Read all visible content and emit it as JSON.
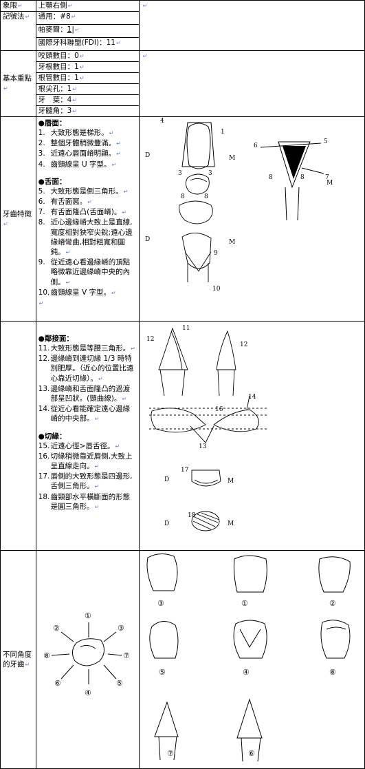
{
  "header": {
    "quadrant_label": "象限",
    "quadrant_value": "上顎右側"
  },
  "notation": {
    "label": "記號法",
    "universal": "通用：#8",
    "palmer_prefix": "帕麥爾：",
    "palmer_value": "1",
    "fdi": "國際牙科聯盟(FDI)：11"
  },
  "basics": {
    "label": "基本重點",
    "items": [
      "咬頭數目：0",
      "牙根數目：1",
      "根管數目：1",
      "根尖孔：1",
      "牙　葉：4",
      "牙髓角：3"
    ]
  },
  "features": {
    "label": "牙齒特徵",
    "labial": {
      "title": "●唇面：",
      "items": [
        {
          "n": "1.",
          "t": "大致形態是梯形。"
        },
        {
          "n": "2.",
          "t": "整個牙體稍微豐滿。"
        },
        {
          "n": "3.",
          "t": "近遠心唇面嵴明顯。"
        },
        {
          "n": "4.",
          "t": "齒頸線呈 U 字型。"
        }
      ]
    },
    "lingual": {
      "title": "●舌面：",
      "items": [
        {
          "n": "5.",
          "t": "大致形態是倒三角形。"
        },
        {
          "n": "6.",
          "t": "有舌面窩。"
        },
        {
          "n": "7.",
          "t": "有舌面隆凸(舌面嵴)。"
        },
        {
          "n": "8.",
          "t": "近心邊緣嵴大致上是直線,寬度相對狹窄尖銳;遠心邊緣嵴彎曲,相對粗寬和圓鈍。"
        },
        {
          "n": "9.",
          "t": "從近遠心看邊緣嵴的頂點略微靠近邊緣嵴中央的內側。"
        },
        {
          "n": "10.",
          "t": "齒頸線呈 V 字型。"
        }
      ]
    },
    "proximal": {
      "title": "●鄰接面：",
      "items": [
        {
          "n": "11.",
          "t": "大致形態是等腰三角形。"
        },
        {
          "n": "12.",
          "t": "邊緣嵴到達切緣 1/3 時特別肥厚。（近心的位置比遠心靠近切緣）。"
        },
        {
          "n": "13.",
          "t": "邊緣嵴和舌面隆凸的過渡部呈凹狀。(頸曲線)。"
        },
        {
          "n": "14.",
          "t": "從近心看能確定遠心邊緣嵴的中央部。"
        }
      ]
    },
    "incisal": {
      "title": "●切緣：",
      "items": [
        {
          "n": "15.",
          "t": "近遠心徑>唇舌徑。"
        },
        {
          "n": "16.",
          "t": "切緣稍微靠近唇側,大致上呈直線走向。"
        },
        {
          "n": "17.",
          "t": "唇側的大致形態是四邊形,舌側三角形。"
        },
        {
          "n": "18.",
          "t": "齒頸部水平橫斷面的形態是圓三角形。"
        }
      ]
    }
  },
  "views": {
    "label": "不同角度的牙齒",
    "circled": [
      "①",
      "②",
      "③",
      "④",
      "⑤",
      "⑥",
      "⑦",
      "⑧"
    ]
  },
  "diagram_labels": {
    "D": "D",
    "M": "M",
    "n1": "1",
    "n3": "3",
    "n4": "4",
    "n5": "5",
    "n6": "6",
    "n7": "7",
    "n8": "8",
    "n9": "9",
    "n10": "10",
    "n11": "11",
    "n12": "12",
    "n13": "13",
    "n14": "14",
    "n16": "16",
    "n17": "17",
    "n18": "18"
  }
}
